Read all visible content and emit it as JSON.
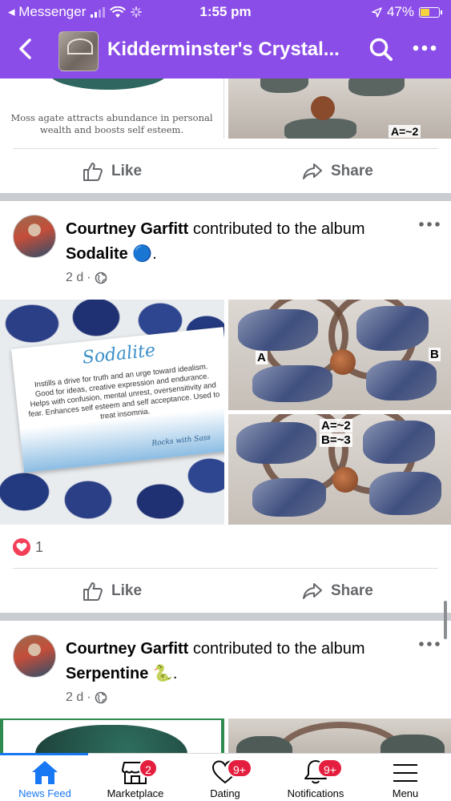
{
  "status_bar": {
    "carrier": "◂ Messenger",
    "time": "1:55 pm",
    "battery": "47%",
    "battery_level": 0.47
  },
  "header": {
    "title": "Kidderminster's Crystal..."
  },
  "previous_post": {
    "card_text": "Moss agate attracts abundance in personal wealth and boosts self esteem.",
    "photo_label": "A=~2"
  },
  "actions": {
    "like": "Like",
    "share": "Share"
  },
  "posts": [
    {
      "author": "Courtney Garfitt",
      "verb": "contributed to the album",
      "album": "Sodalite",
      "emoji": "🔵",
      "time": "2 d",
      "card_title": "Sodalite",
      "card_text": "Instills a drive for truth and an urge toward idealism. Good for ideas, creative expression and endurance. Helps with confusion, mental unrest, oversensitivity and fear. Enhances self esteem and self acceptance. Used to treat insomnia.",
      "card_brand": "Rocks with Sass",
      "photo1_labels": [
        "A",
        "B"
      ],
      "photo2_labels": [
        "A=~2",
        "B=~3"
      ],
      "reaction_count": "1"
    },
    {
      "author": "Courtney Garfitt",
      "verb": "contributed to the album",
      "album": "Serpentine",
      "emoji": "🐍",
      "time": "2 d"
    }
  ],
  "tabbar": {
    "tabs": [
      {
        "label": "News Feed",
        "icon": "home-icon"
      },
      {
        "label": "Marketplace",
        "icon": "marketplace-icon",
        "badge": "2"
      },
      {
        "label": "Dating",
        "icon": "heart-icon",
        "badge": "9+"
      },
      {
        "label": "Notifications",
        "icon": "bell-icon",
        "badge": "9+"
      },
      {
        "label": "Menu",
        "icon": "hamburger-icon"
      }
    ],
    "active_color": "#1877f2"
  },
  "colors": {
    "header": "#8b4de8",
    "badge": "#e41e3f",
    "muted": "#65676b"
  }
}
